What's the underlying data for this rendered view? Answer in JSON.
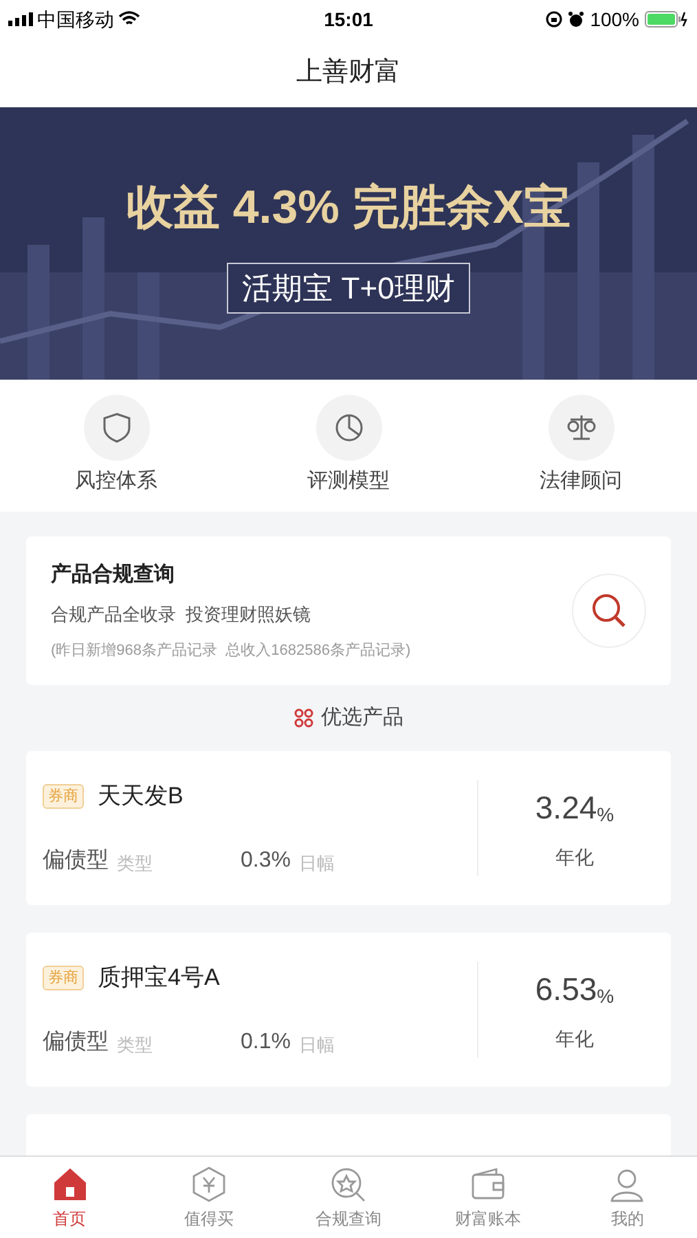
{
  "status_bar": {
    "carrier": "中国移动",
    "time": "15:01",
    "battery": "100%"
  },
  "nav": {
    "title": "上善财富"
  },
  "banner": {
    "headline": "收益 4.3% 完胜余X宝",
    "subtitle": "活期宝 T+0理财"
  },
  "shortcuts": [
    {
      "label": "风控体系",
      "kind": "shield"
    },
    {
      "label": "评测模型",
      "kind": "pie"
    },
    {
      "label": "法律顾问",
      "kind": "scale"
    }
  ],
  "compliance": {
    "title": "产品合规查询",
    "subtitle": "合规产品全收录  投资理财照妖镜",
    "note": "(昨日新增968条产品记录  总收入1682586条产品记录)"
  },
  "section_title": "优选产品",
  "products": [
    {
      "tag": "券商",
      "name": "天天发B",
      "type": "偏债型",
      "type_label": "类型",
      "change": "0.3%",
      "change_label": "日幅",
      "rate": "3.24",
      "rate_unit": "%",
      "rate_label": "年化"
    },
    {
      "tag": "券商",
      "name": "质押宝4号A",
      "type": "偏债型",
      "type_label": "类型",
      "change": "0.1%",
      "change_label": "日幅",
      "rate": "6.53",
      "rate_unit": "%",
      "rate_label": "年化"
    }
  ],
  "tabs": [
    {
      "label": "首页",
      "kind": "home",
      "selected": true
    },
    {
      "label": "值得买",
      "kind": "yen",
      "selected": false
    },
    {
      "label": "合规查询",
      "kind": "search",
      "selected": false
    },
    {
      "label": "财富账本",
      "kind": "wallet",
      "selected": false
    },
    {
      "label": "我的",
      "kind": "user",
      "selected": false
    }
  ]
}
